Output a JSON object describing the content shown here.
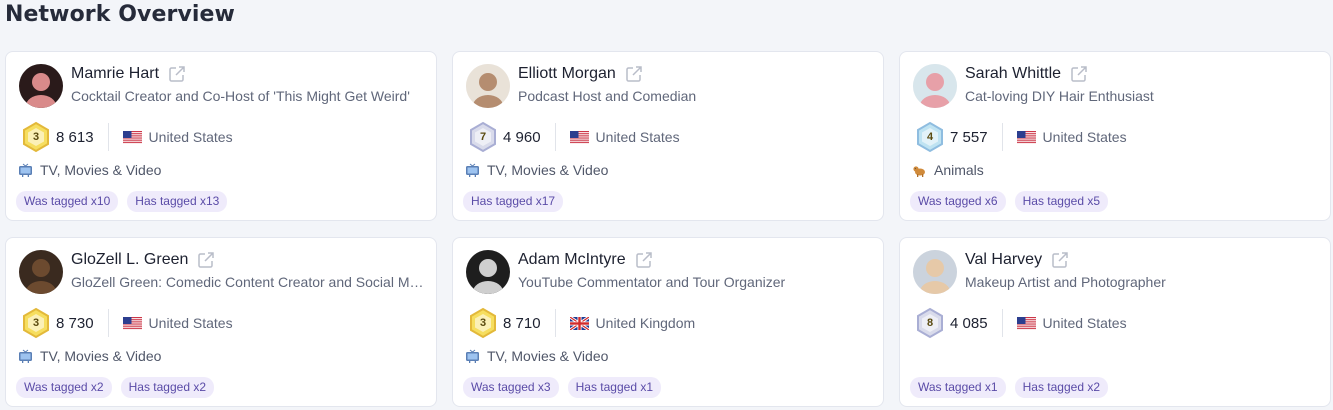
{
  "page": {
    "title": "Network Overview"
  },
  "colors": {
    "tag_bg": "#efebfb",
    "tag_text": "#5a4ba7",
    "badge_gold": "#f2d44b",
    "badge_silver": "#c9cce8"
  },
  "cards": [
    {
      "name": "Mamrie Hart",
      "tagline": "Cocktail Creator and Co-Host of 'This Might Get Weird'",
      "level": "3",
      "badge": "gold",
      "count": "8 613",
      "country": "United States",
      "flag": "us-flag-icon",
      "category": "TV, Movies & Video",
      "category_icon": "tv-icon",
      "tags": [
        "Was tagged x10",
        "Has tagged x13"
      ]
    },
    {
      "name": "Elliott Morgan",
      "tagline": "Podcast Host and Comedian",
      "level": "7",
      "badge": "silver",
      "count": "4 960",
      "country": "United States",
      "flag": "us-flag-icon",
      "category": "TV, Movies & Video",
      "category_icon": "tv-icon",
      "tags": [
        "Has tagged x17"
      ]
    },
    {
      "name": "Sarah Whittle",
      "tagline": "Cat-loving DIY Hair Enthusiast",
      "level": "4",
      "badge": "blue",
      "count": "7 557",
      "country": "United States",
      "flag": "us-flag-icon",
      "category": "Animals",
      "category_icon": "dog-icon",
      "tags": [
        "Was tagged x6",
        "Has tagged x5"
      ]
    },
    {
      "name": "GloZell L. Green",
      "tagline": "GloZell Green: Comedic Content Creator and Social Media Personality",
      "level": "3",
      "badge": "gold",
      "count": "8 730",
      "country": "United States",
      "flag": "us-flag-icon",
      "category": "TV, Movies & Video",
      "category_icon": "tv-icon",
      "tags": [
        "Was tagged x2",
        "Has tagged x2"
      ]
    },
    {
      "name": "Adam McIntyre",
      "tagline": "YouTube Commentator and Tour Organizer",
      "level": "3",
      "badge": "gold",
      "count": "8 710",
      "country": "United Kingdom",
      "flag": "uk-flag-icon",
      "category": "TV, Movies & Video",
      "category_icon": "tv-icon",
      "tags": [
        "Was tagged x3",
        "Has tagged x1"
      ]
    },
    {
      "name": "Val Harvey",
      "tagline": "Makeup Artist and Photographer",
      "level": "8",
      "badge": "silver",
      "count": "4 085",
      "country": "United States",
      "flag": "us-flag-icon",
      "category": "",
      "category_icon": "",
      "tags": [
        "Was tagged x1",
        "Has tagged x2"
      ]
    }
  ]
}
